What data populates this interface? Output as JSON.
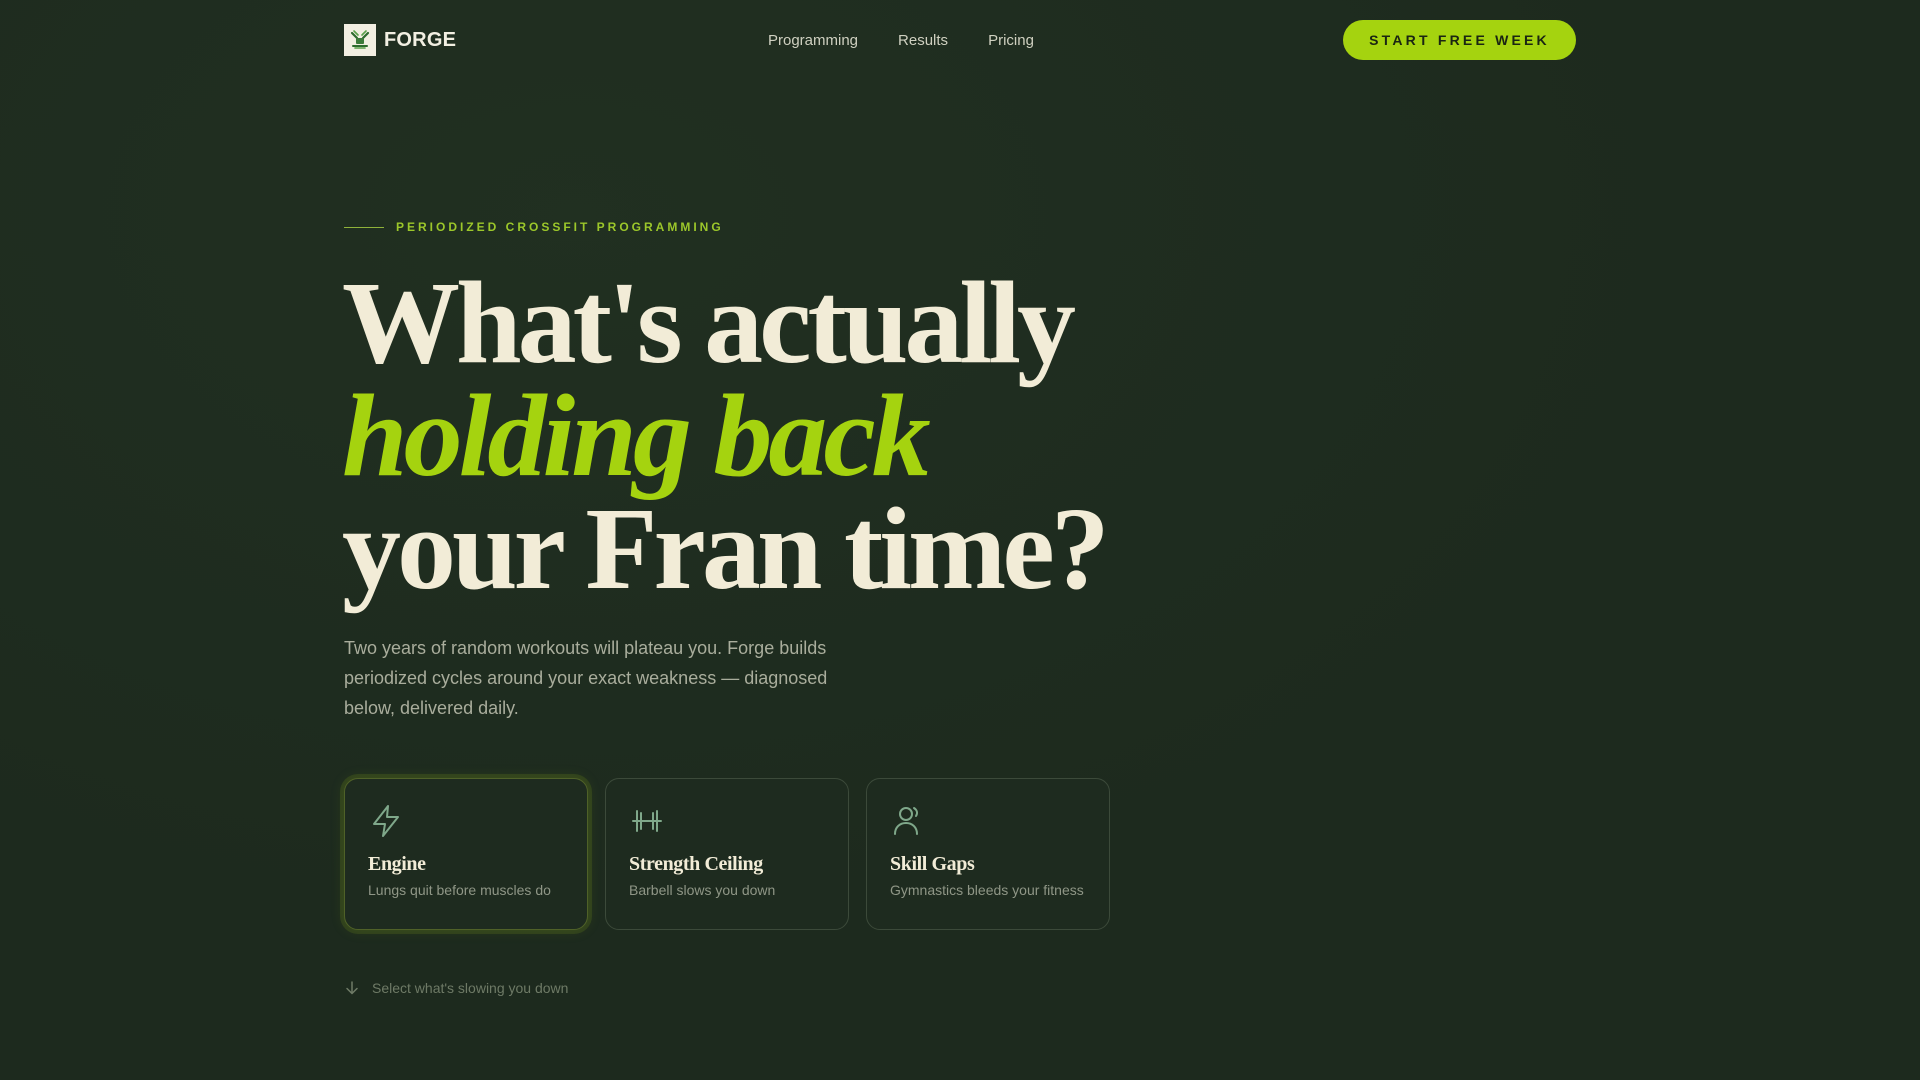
{
  "nav": {
    "brand": "FORGE",
    "links": [
      "Programming",
      "Results",
      "Pricing"
    ],
    "cta": "START FREE WEEK"
  },
  "hero": {
    "eyebrow": "PERIODIZED CROSSFIT PROGRAMMING",
    "headline": {
      "line1": "What's actually",
      "line2": "holding back",
      "line3": "your Fran time?"
    },
    "subcopy": "Two years of random workouts will plateau you. Forge builds periodized cycles around your exact weakness — diagnosed below, delivered daily."
  },
  "cards": [
    {
      "title": "Engine",
      "desc": "Lungs quit before muscles do",
      "icon": "lightning-icon",
      "selected": true
    },
    {
      "title": "Strength Ceiling",
      "desc": "Barbell slows you down",
      "icon": "barbell-icon",
      "selected": false
    },
    {
      "title": "Skill Gaps",
      "desc": "Gymnastics bleeds your fitness",
      "icon": "gymnast-icon",
      "selected": false
    }
  ],
  "hint": {
    "text": "Select what's slowing you down",
    "icon": "arrow-down-icon"
  },
  "colors": {
    "background": "#1d2a1e",
    "accent": "#a5d30f",
    "cream": "#f2ecd7",
    "icon": "#7fa88a"
  }
}
